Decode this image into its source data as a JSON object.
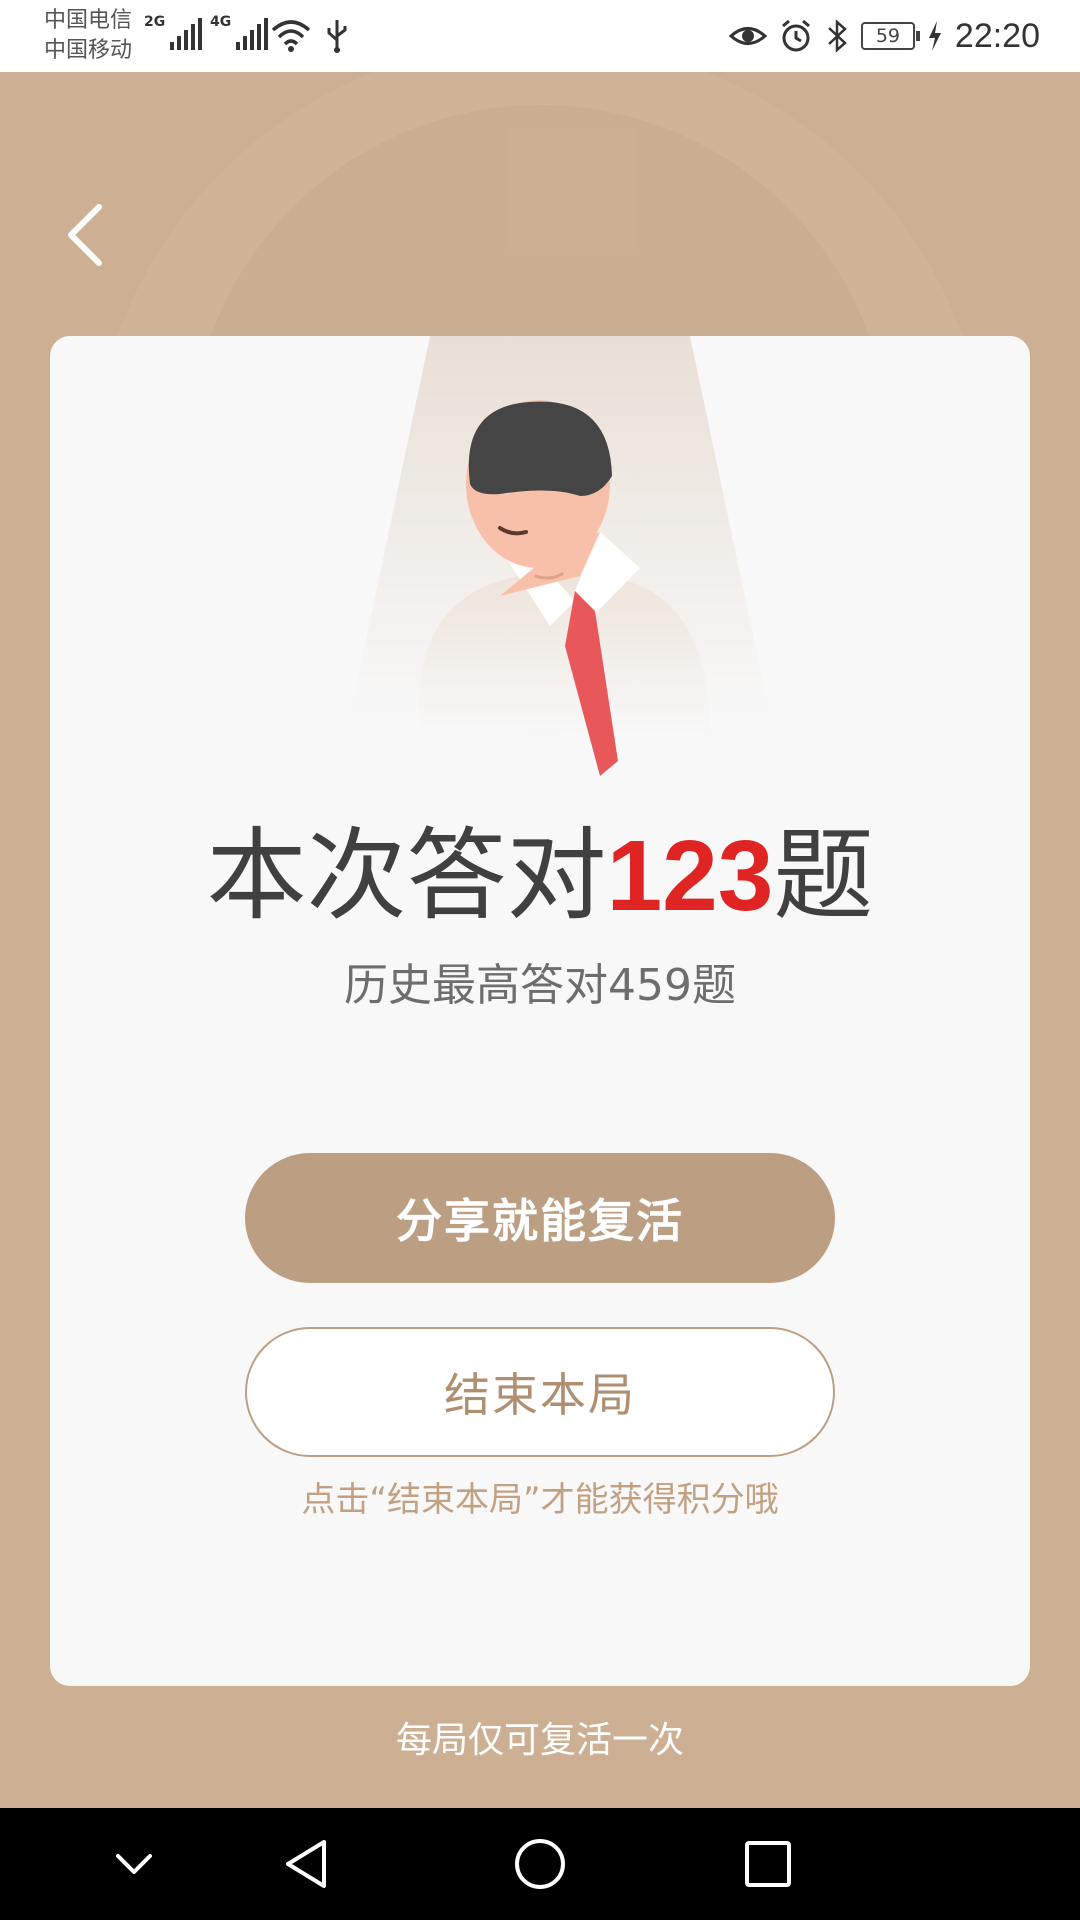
{
  "status_bar": {
    "carrier_1": "中国电信",
    "carrier_2": "中国移动",
    "network_1": "2G",
    "network_2": "4G",
    "battery": "59",
    "time": "22:20",
    "icons": [
      "signal-icon",
      "wifi-icon",
      "usb-icon",
      "eye-icon",
      "alarm-icon",
      "bluetooth-icon",
      "battery-icon",
      "charging-icon"
    ]
  },
  "header": {
    "back_icon": "back-arrow-icon"
  },
  "result": {
    "score_prefix": "本次答对",
    "score_value": "123",
    "score_suffix": "题",
    "best_text": "历史最高答对459题"
  },
  "actions": {
    "revive_label": "分享就能复活",
    "end_label": "结束本局",
    "hint": "点击“结束本局”才能获得积分哦"
  },
  "footer_note": "每局仅可复活一次",
  "navigation": {
    "icons": [
      "chevron-down-icon",
      "nav-back-icon",
      "nav-home-icon",
      "nav-recents-icon"
    ]
  },
  "colors": {
    "background": "#cdb093",
    "card": "#f8f8f8",
    "accent": "#bc9e82",
    "score_highlight": "#e02323",
    "tie": "#e8585a"
  }
}
